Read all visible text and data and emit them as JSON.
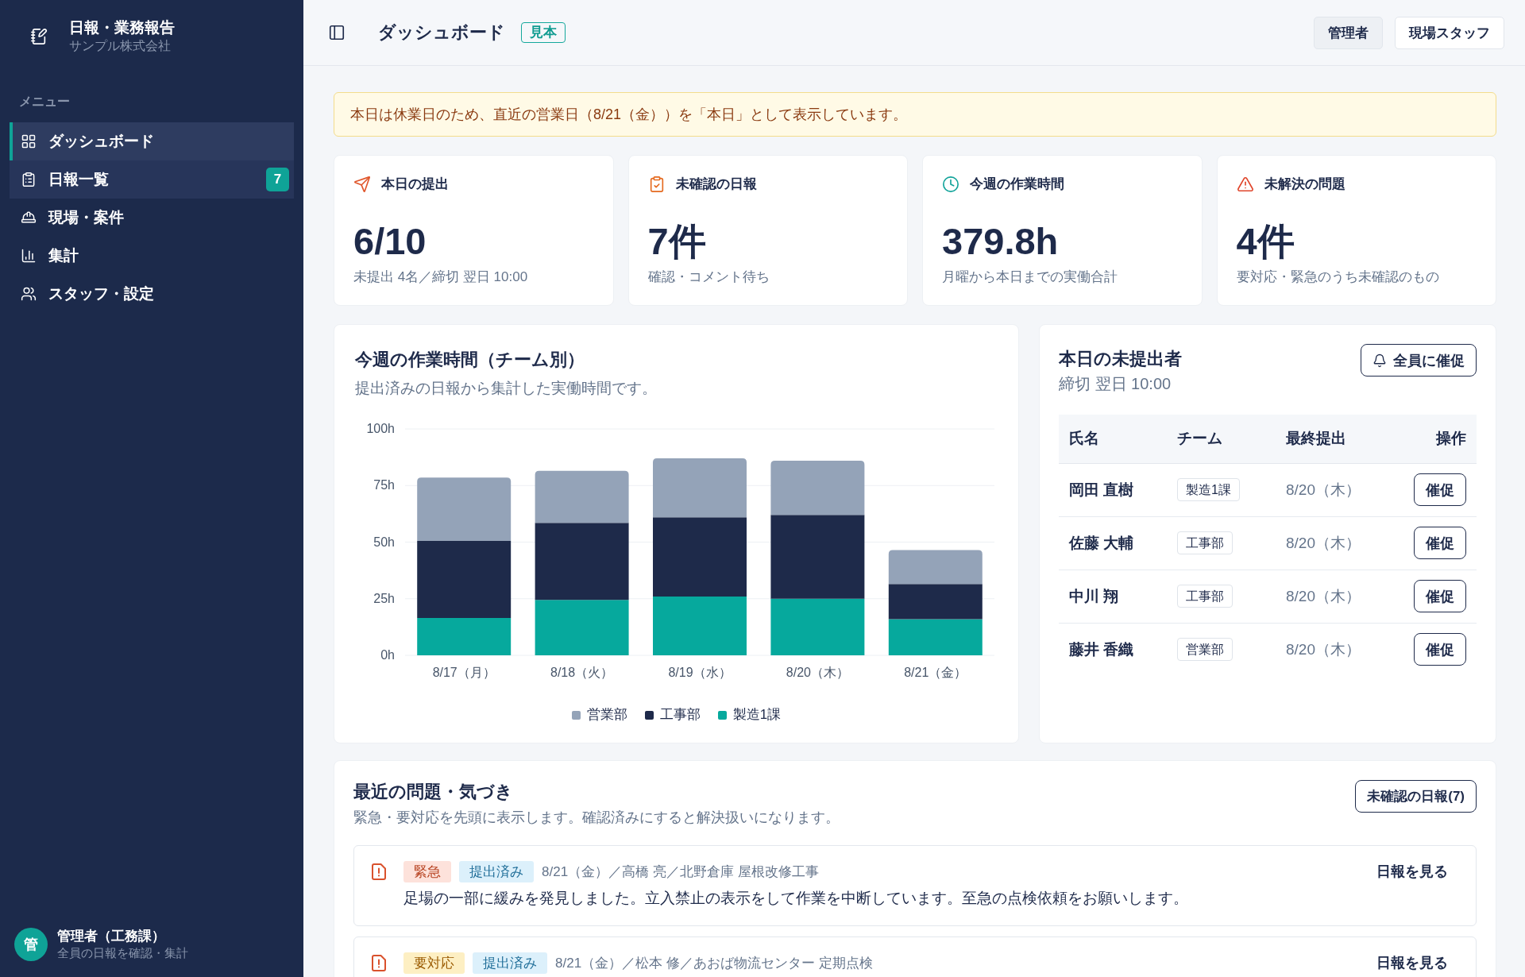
{
  "sidebar": {
    "brand": {
      "title": "日報・業務報告",
      "subtitle": "サンプル株式会社"
    },
    "menu_label": "メニュー",
    "items": [
      {
        "label": "ダッシュボード",
        "selected": true,
        "hovered": false
      },
      {
        "label": "日報一覧",
        "selected": false,
        "hovered": true,
        "badge": "7"
      },
      {
        "label": "現場・案件",
        "selected": false,
        "hovered": false
      },
      {
        "label": "集計",
        "selected": false,
        "hovered": false
      },
      {
        "label": "スタッフ・設定",
        "selected": false,
        "hovered": false
      }
    ],
    "user": {
      "avatar": "管",
      "name": "管理者（工務課）",
      "role": "全員の日報を確認・集計"
    }
  },
  "header": {
    "title": "ダッシュボード",
    "badge": "見本",
    "roles": [
      {
        "label": "管理者",
        "selected": true
      },
      {
        "label": "現場スタッフ",
        "selected": false
      }
    ]
  },
  "notice": "本日は休業日のため、直近の営業日（8/21（金））を「本日」として表示しています。",
  "stats": [
    {
      "label": "本日の提出",
      "value": "6/10",
      "note": "未提出 4名／締切 翌日 10:00",
      "color": "#e0562b"
    },
    {
      "label": "未確認の日報",
      "value": "7件",
      "note": "確認・コメント待ち",
      "color": "#e56a1f"
    },
    {
      "label": "今週の作業時間",
      "value": "379.8h",
      "note": "月曜から本日までの実働合計",
      "color": "#11a39a"
    },
    {
      "label": "未解決の問題",
      "value": "4件",
      "note": "要対応・緊急のうち未確認のもの",
      "color": "#e0452b"
    }
  ],
  "weekly_hours": {
    "title": "今週の作業時間（チーム別）",
    "subtitle": "提出済みの日報から集計した実働時間です。",
    "chart_data": {
      "type": "bar",
      "stacked": true,
      "grid": true,
      "legend": true,
      "categories": [
        "8/17（月）",
        "8/18（火）",
        "8/19（水）",
        "8/20（木）",
        "8/21（金）"
      ],
      "series": [
        {
          "name": "営業部",
          "color": "#94a3b8",
          "values": [
            28,
            23,
            26,
            24,
            15
          ]
        },
        {
          "name": "工事部",
          "color": "#1e2a4a",
          "values": [
            34,
            34,
            35,
            37,
            15.5
          ]
        },
        {
          "name": "製造1課",
          "color": "#06a99d",
          "values": [
            16.5,
            24.5,
            26,
            25,
            16
          ]
        }
      ],
      "ylim": [
        0,
        100
      ],
      "yticks": [
        {
          "value": 0,
          "label": "0h"
        },
        {
          "value": 25,
          "label": "25h"
        },
        {
          "value": 50,
          "label": "50h"
        },
        {
          "value": 75,
          "label": "75h"
        },
        {
          "value": 100,
          "label": "100h"
        }
      ]
    }
  },
  "unsubmitted": {
    "title": "本日の未提出者",
    "subtitle": "締切 翌日 10:00",
    "remind_all": "全員に催促",
    "columns": [
      "氏名",
      "チーム",
      "最終提出",
      "操作"
    ],
    "rows": [
      {
        "name": "岡田 直樹",
        "team": "製造1課",
        "last_submitted": "8/20（木）",
        "action": "催促"
      },
      {
        "name": "佐藤 大輔",
        "team": "工事部",
        "last_submitted": "8/20（木）",
        "action": "催促"
      },
      {
        "name": "中川 翔",
        "team": "工事部",
        "last_submitted": "8/20（木）",
        "action": "催促"
      },
      {
        "name": "藤井 香織",
        "team": "営業部",
        "last_submitted": "8/20（木）",
        "action": "催促"
      }
    ]
  },
  "issues": {
    "title": "最近の問題・気づき",
    "subtitle": "緊急・要対応を先頭に表示します。確認済みにすると解決扱いになります。",
    "button": "未確認の日報(7)",
    "items": [
      {
        "tags": [
          {
            "label": "緊急",
            "kind": "urgent"
          },
          {
            "label": "提出済み",
            "kind": "submitted"
          }
        ],
        "meta": "8/21（金）／高橋 亮／北野倉庫 屋根改修工事",
        "body": "足場の一部に緩みを発見しました。立入禁止の表示をして作業を中断しています。至急の点検依頼をお願いします。",
        "link": "日報を見る"
      },
      {
        "tags": [
          {
            "label": "要対応",
            "kind": "action"
          },
          {
            "label": "提出済み",
            "kind": "submitted"
          }
        ],
        "meta": "8/21（金）／松本 修／あおば物流センター 定期点検",
        "link": "日報を見る"
      }
    ]
  }
}
